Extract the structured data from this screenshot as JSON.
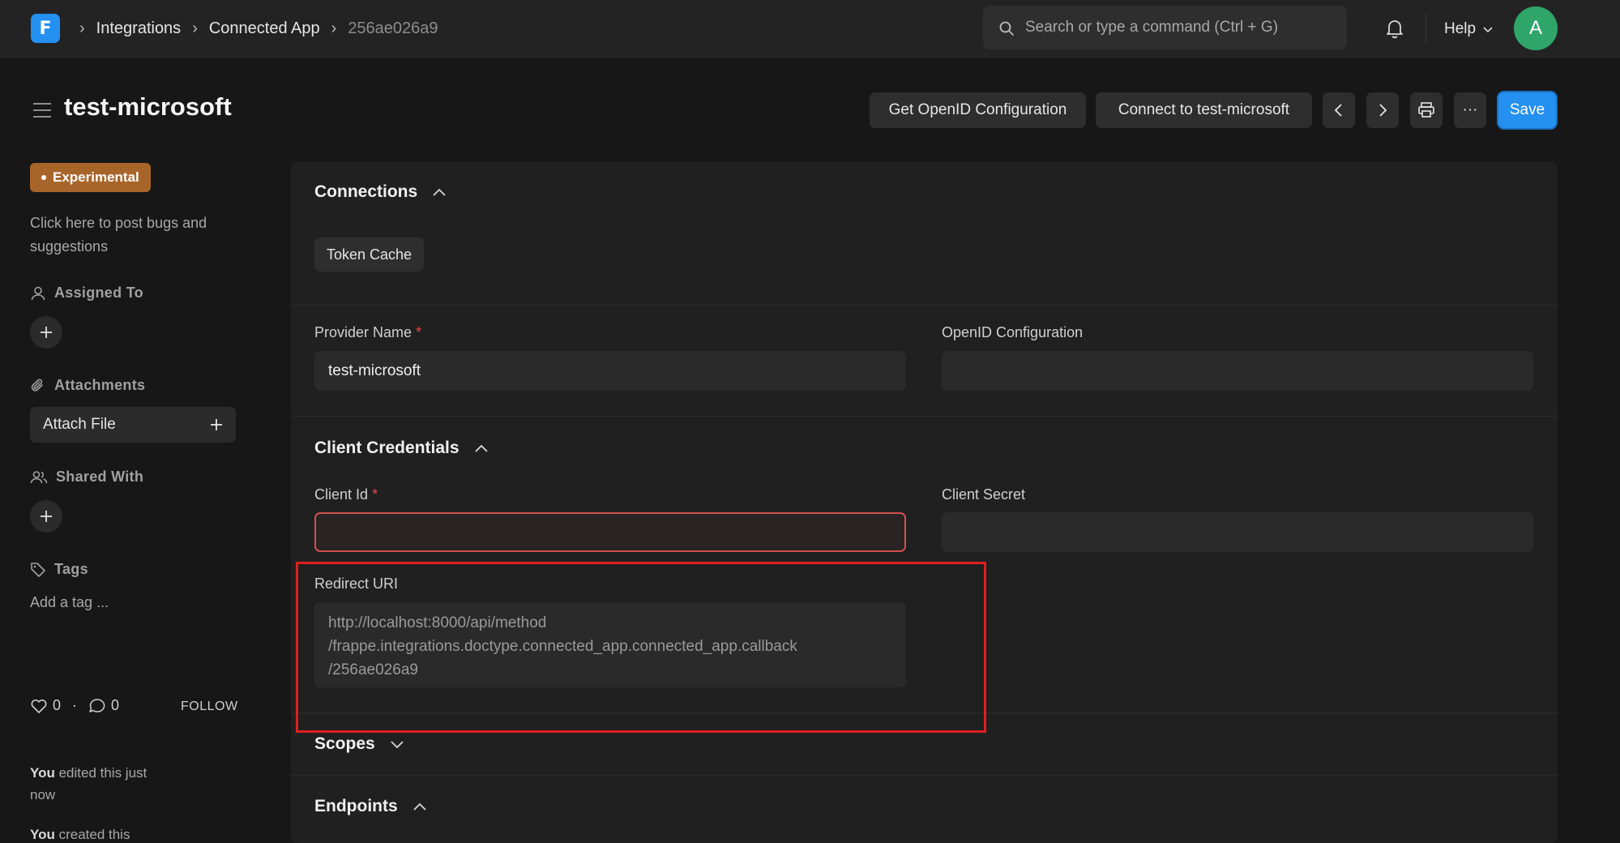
{
  "navbar": {
    "logo": "F",
    "breadcrumbs": [
      "Integrations",
      "Connected App",
      "256ae026a9"
    ],
    "search_placeholder": "Search or type a command (Ctrl + G)",
    "help_label": "Help",
    "avatar_initial": "A"
  },
  "header": {
    "title": "test-microsoft",
    "get_openid_label": "Get OpenID Configuration",
    "connect_label": "Connect to test-microsoft",
    "more_label": "···",
    "save_label": "Save"
  },
  "sidebar": {
    "badge": "Experimental",
    "bug_note": "Click here to post bugs and suggestions",
    "assigned_to": "Assigned To",
    "attachments": "Attachments",
    "attach_file": "Attach File",
    "shared_with": "Shared With",
    "tags": "Tags",
    "add_tag": "Add a tag ...",
    "likes": "0",
    "separator": "·",
    "comments": "0",
    "follow": "FOLLOW",
    "activity": [
      {
        "who": "You",
        "text": " edited this just now"
      },
      {
        "who": "You",
        "text": " created this"
      }
    ]
  },
  "form": {
    "connections": {
      "title": "Connections",
      "chip": "Token Cache"
    },
    "provider_name": {
      "label": "Provider Name",
      "required": "*",
      "value": "test-microsoft"
    },
    "openid_configuration": {
      "label": "OpenID Configuration",
      "value": ""
    },
    "client_credentials": {
      "title": "Client Credentials",
      "client_id": {
        "label": "Client Id",
        "required": "*",
        "value": ""
      },
      "client_secret": {
        "label": "Client Secret",
        "value": ""
      },
      "redirect_uri": {
        "label": "Redirect URI",
        "line1": "http://localhost:8000/api/method",
        "line2": "/frappe.integrations.doctype.connected_app.connected_app.callback",
        "line3": "/256ae026a9"
      }
    },
    "scopes": {
      "title": "Scopes"
    },
    "endpoints": {
      "title": "Endpoints"
    }
  },
  "colors": {
    "accent": "#2490ef",
    "badge": "#a8652a",
    "error": "#d2514e",
    "highlight": "#e01e1e",
    "avatar": "#2fa56a"
  }
}
